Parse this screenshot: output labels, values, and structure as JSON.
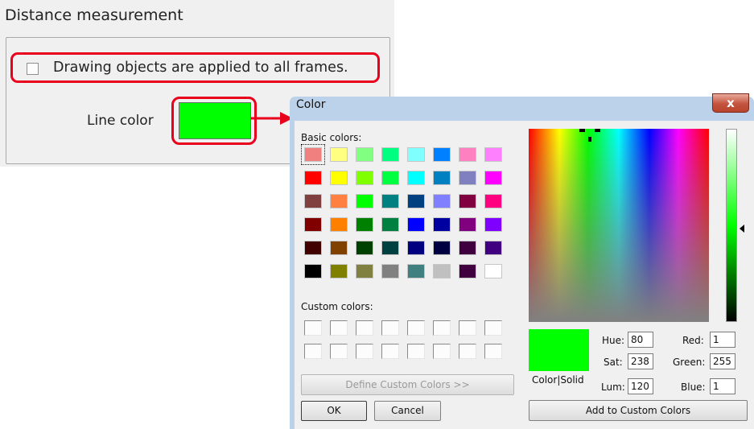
{
  "distance_panel": {
    "title": "Distance measurement",
    "apply_all_frames_label": "Drawing objects are applied to all frames.",
    "apply_all_frames_checked": false,
    "line_color_label": "Line color",
    "line_color_value": "#00ff00"
  },
  "color_dialog": {
    "title": "Color",
    "close_glyph": "x",
    "basic_colors_label": "Basic colors:",
    "basic_colors": [
      [
        "#f08080",
        "#ffff80",
        "#80ff80",
        "#00ff80",
        "#80ffff",
        "#0080ff",
        "#ff80c0",
        "#ff80ff"
      ],
      [
        "#ff0000",
        "#ffff00",
        "#80ff00",
        "#00ff40",
        "#00ffff",
        "#0080c0",
        "#8080c0",
        "#ff00ff"
      ],
      [
        "#804040",
        "#ff8040",
        "#00ff00",
        "#008080",
        "#004080",
        "#8080ff",
        "#800040",
        "#ff0080"
      ],
      [
        "#800000",
        "#ff8000",
        "#008000",
        "#008040",
        "#0000ff",
        "#0000a0",
        "#800080",
        "#8000ff"
      ],
      [
        "#400000",
        "#804000",
        "#004000",
        "#004040",
        "#000080",
        "#000040",
        "#400040",
        "#400080"
      ],
      [
        "#000000",
        "#808000",
        "#808040",
        "#808080",
        "#408080",
        "#c0c0c0",
        "#400040",
        "#ffffff"
      ]
    ],
    "selected_basic_color": "#f08080",
    "custom_colors_label": "Custom colors:",
    "define_custom_label": "Define Custom Colors >>",
    "ok_label": "OK",
    "cancel_label": "Cancel",
    "color_solid_label": "Color|Solid",
    "current_color": "#00ff00",
    "hue_label": "Hue:",
    "hue_value": "80",
    "sat_label": "Sat:",
    "sat_value": "238",
    "lum_label": "Lum:",
    "lum_value": "120",
    "red_label": "Red:",
    "red_value": "1",
    "green_label": "Green:",
    "green_value": "255",
    "blue_label": "Blue:",
    "blue_value": "1",
    "add_custom_label": "Add to Custom Colors"
  },
  "highlight_color": "#e8001c"
}
